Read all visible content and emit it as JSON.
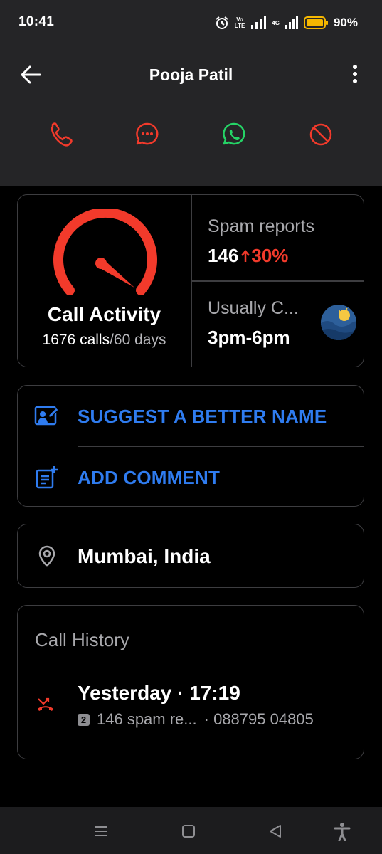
{
  "status": {
    "time": "10:41",
    "volte_top": "Vo",
    "volte_bottom": "LTE",
    "network": "4G",
    "battery": "90%"
  },
  "header": {
    "title": "Pooja Patil"
  },
  "actions": [
    {
      "icon": "phone-icon",
      "color": "#f23a2b"
    },
    {
      "icon": "message-icon",
      "color": "#f23a2b"
    },
    {
      "icon": "whatsapp-icon",
      "color": "#25d366"
    },
    {
      "icon": "block-icon",
      "color": "#f23a2b"
    }
  ],
  "activity": {
    "title": "Call Activity",
    "calls": "1676 calls",
    "period": "/60 days",
    "spam_label": "Spam reports",
    "spam_value": "146",
    "spam_change": "30%",
    "usually_label": "Usually C...",
    "usually_value": "3pm-6pm"
  },
  "links": {
    "suggest_label": "SUGGEST A BETTER NAME",
    "comment_label": "ADD COMMENT"
  },
  "location": {
    "label": "Mumbai, India"
  },
  "history": {
    "title": "Call History",
    "entries": [
      {
        "when": "Yesterday · 17:19",
        "sim": "2",
        "detail": "146 spam re...",
        "number": "· 088795 04805"
      }
    ]
  },
  "colors": {
    "accent_blue": "#2f7cf0",
    "spam_red": "#f23a2b",
    "whatsapp_green": "#25d366",
    "top_bg": "#252527"
  }
}
